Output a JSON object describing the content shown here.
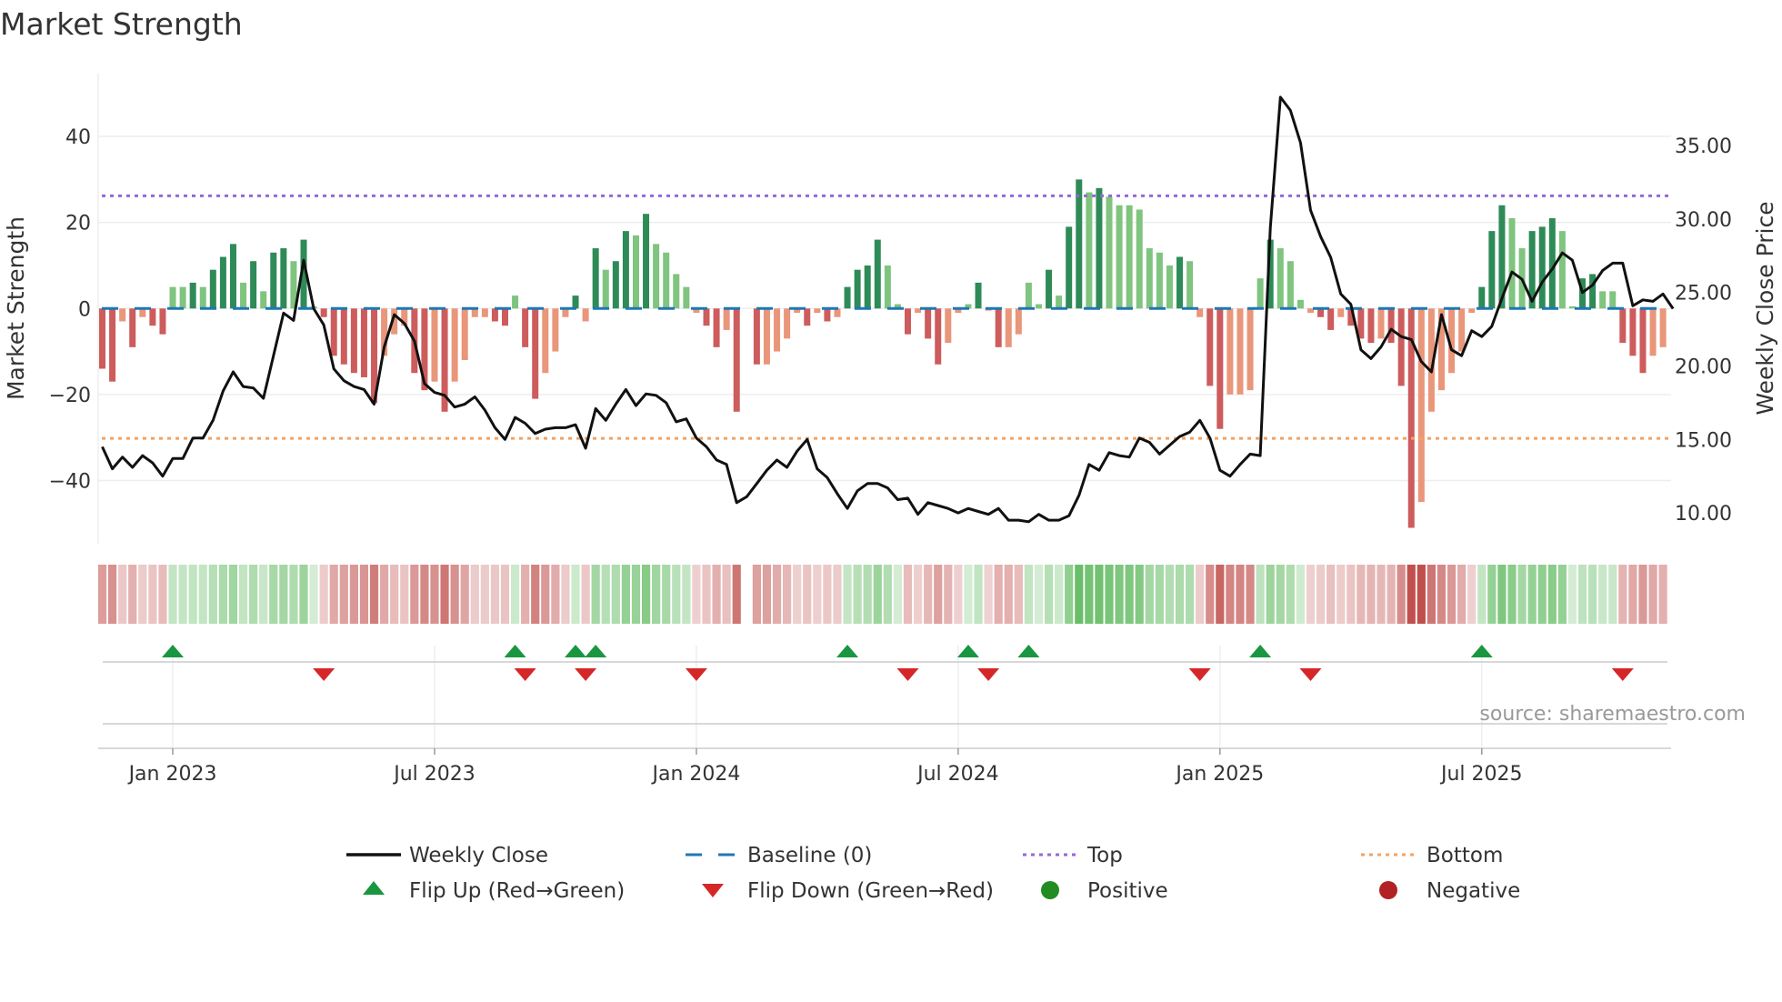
{
  "chart_data": {
    "type": "bar",
    "title": "Market Strength",
    "ylabel": "Market Strength",
    "y2label": "Weekly Close Price",
    "ylim": [
      -54.7,
      54.6
    ],
    "y2lim": [
      7.9,
      39.9
    ],
    "yticks": [
      "40",
      "20",
      "0",
      "−20",
      "−40"
    ],
    "ytick_values": [
      40,
      20,
      0,
      -20,
      -40
    ],
    "y2ticks": [
      "35.00",
      "30.00",
      "25.00",
      "20.00",
      "15.00",
      "10.00"
    ],
    "y2tick_values": [
      35,
      30,
      25,
      20,
      15,
      10
    ],
    "xticks": [
      "Jan 2023",
      "Jul 2023",
      "Jan 2024",
      "Jul 2024",
      "Jan 2025",
      "Jul 2025"
    ],
    "xtick_week_index": [
      7,
      33,
      59,
      85,
      111,
      137
    ],
    "top_level": 26.2,
    "bottom_level": -30.2,
    "baseline": 0,
    "grid": true,
    "strength": [
      -14,
      -17,
      -3,
      -9,
      -2,
      -4,
      -6,
      5,
      5,
      6,
      5,
      9,
      12,
      15,
      6,
      11,
      4,
      13,
      14,
      11,
      16,
      0.5,
      -2,
      -11,
      -13,
      -15,
      -16,
      -22,
      -11,
      -6,
      -4,
      -15,
      -19,
      -17,
      -24,
      -17,
      -12,
      -2,
      -2,
      -3,
      -4,
      3,
      -9,
      -21,
      -15,
      -10,
      -2,
      3,
      -3,
      14,
      9,
      11,
      18,
      17,
      22,
      15,
      13,
      8,
      5,
      -1,
      -4,
      -9,
      -5,
      -24,
      null,
      -13,
      -13,
      -10,
      -7,
      -1,
      -4,
      -1,
      -3,
      -2,
      5,
      9,
      10,
      16,
      10,
      1,
      -6,
      -1,
      -7,
      -13,
      -8,
      -1,
      1,
      6,
      -0.5,
      -9,
      -9,
      -6,
      6,
      1,
      9,
      3,
      19,
      30,
      27,
      28,
      26,
      24,
      24,
      23,
      14,
      13,
      10,
      12,
      11,
      -2,
      -18,
      -28,
      -20,
      -20,
      -19,
      7,
      16,
      14,
      11,
      2,
      -1,
      -2,
      -5,
      -2,
      -4,
      -7,
      -8,
      -7,
      -8,
      -18,
      -51,
      -45,
      -24,
      -19,
      -15,
      -10,
      -1,
      5,
      18,
      24,
      21,
      14,
      18,
      19,
      21,
      18,
      0.5,
      7,
      8,
      4,
      4,
      -8,
      -11,
      -15,
      -11,
      -9
    ],
    "weekly_close": [
      14.5,
      13,
      13.8,
      13.1,
      13.9,
      13.4,
      12.5,
      13.7,
      13.7,
      15.1,
      15.1,
      16.3,
      18.3,
      19.6,
      18.6,
      18.5,
      17.8,
      20.7,
      23.6,
      23.1,
      27.2,
      23.9,
      22.8,
      19.8,
      19,
      18.6,
      18.4,
      17.4,
      21.3,
      23.5,
      22.9,
      21.7,
      18.8,
      18.2,
      18,
      17.2,
      17.4,
      17.9,
      17,
      15.8,
      15,
      16.5,
      16.1,
      15.4,
      15.7,
      15.8,
      15.8,
      16,
      14.4,
      17.1,
      16.3,
      17.4,
      18.4,
      17.3,
      18.1,
      18,
      17.5,
      16.2,
      16.4,
      15.1,
      14.5,
      13.6,
      13.3,
      10.7,
      11.1,
      12,
      12.9,
      13.6,
      13.1,
      14.2,
      15,
      13,
      12.4,
      11.3,
      10.3,
      11.5,
      12,
      12,
      11.7,
      10.9,
      11,
      9.9,
      10.7,
      10.5,
      10.3,
      10,
      10.3,
      10.1,
      9.9,
      10.3,
      9.5,
      9.5,
      9.4,
      9.9,
      9.5,
      9.5,
      9.8,
      11.2,
      13.3,
      12.9,
      14.1,
      13.9,
      13.8,
      15.1,
      14.8,
      14,
      14.6,
      15.2,
      15.5,
      16.3,
      15.1,
      12.9,
      12.5,
      13.3,
      14,
      13.9,
      29.4,
      38.3,
      37.4,
      35.2,
      30.6,
      28.8,
      27.4,
      24.9,
      24.2,
      21.1,
      20.5,
      21.3,
      22.5,
      22,
      21.8,
      20.3,
      19.6,
      23.5,
      21.1,
      20.7,
      22.4,
      22,
      22.7,
      24.6,
      26.4,
      25.9,
      24.4,
      25.7,
      26.6,
      27.7,
      27.2,
      25,
      25.5,
      26.5,
      27,
      27,
      24.1,
      24.5,
      24.4,
      24.9,
      23.9
    ],
    "legend": {
      "placement": "bottom",
      "entries": [
        "Weekly Close",
        "Baseline (0)",
        "Top",
        "Bottom",
        "Flip Up (Red→Green)",
        "Flip Down (Green→Red)",
        "Positive",
        "Negative"
      ]
    },
    "colors": {
      "pos_strong": "#2e8b57",
      "pos_weak": "#7fc47f",
      "neg_strong": "#cd5c5c",
      "neg_weak": "#e9967a",
      "baseline": "#1f77b4",
      "top": "#9467d9",
      "bottom": "#f4a261",
      "close": "#111111",
      "flip_up": "#1a9641",
      "flip_down": "#d62728",
      "positive_dot": "#228b22",
      "negative_dot": "#b22222"
    },
    "source": "source: sharemaestro.com"
  }
}
